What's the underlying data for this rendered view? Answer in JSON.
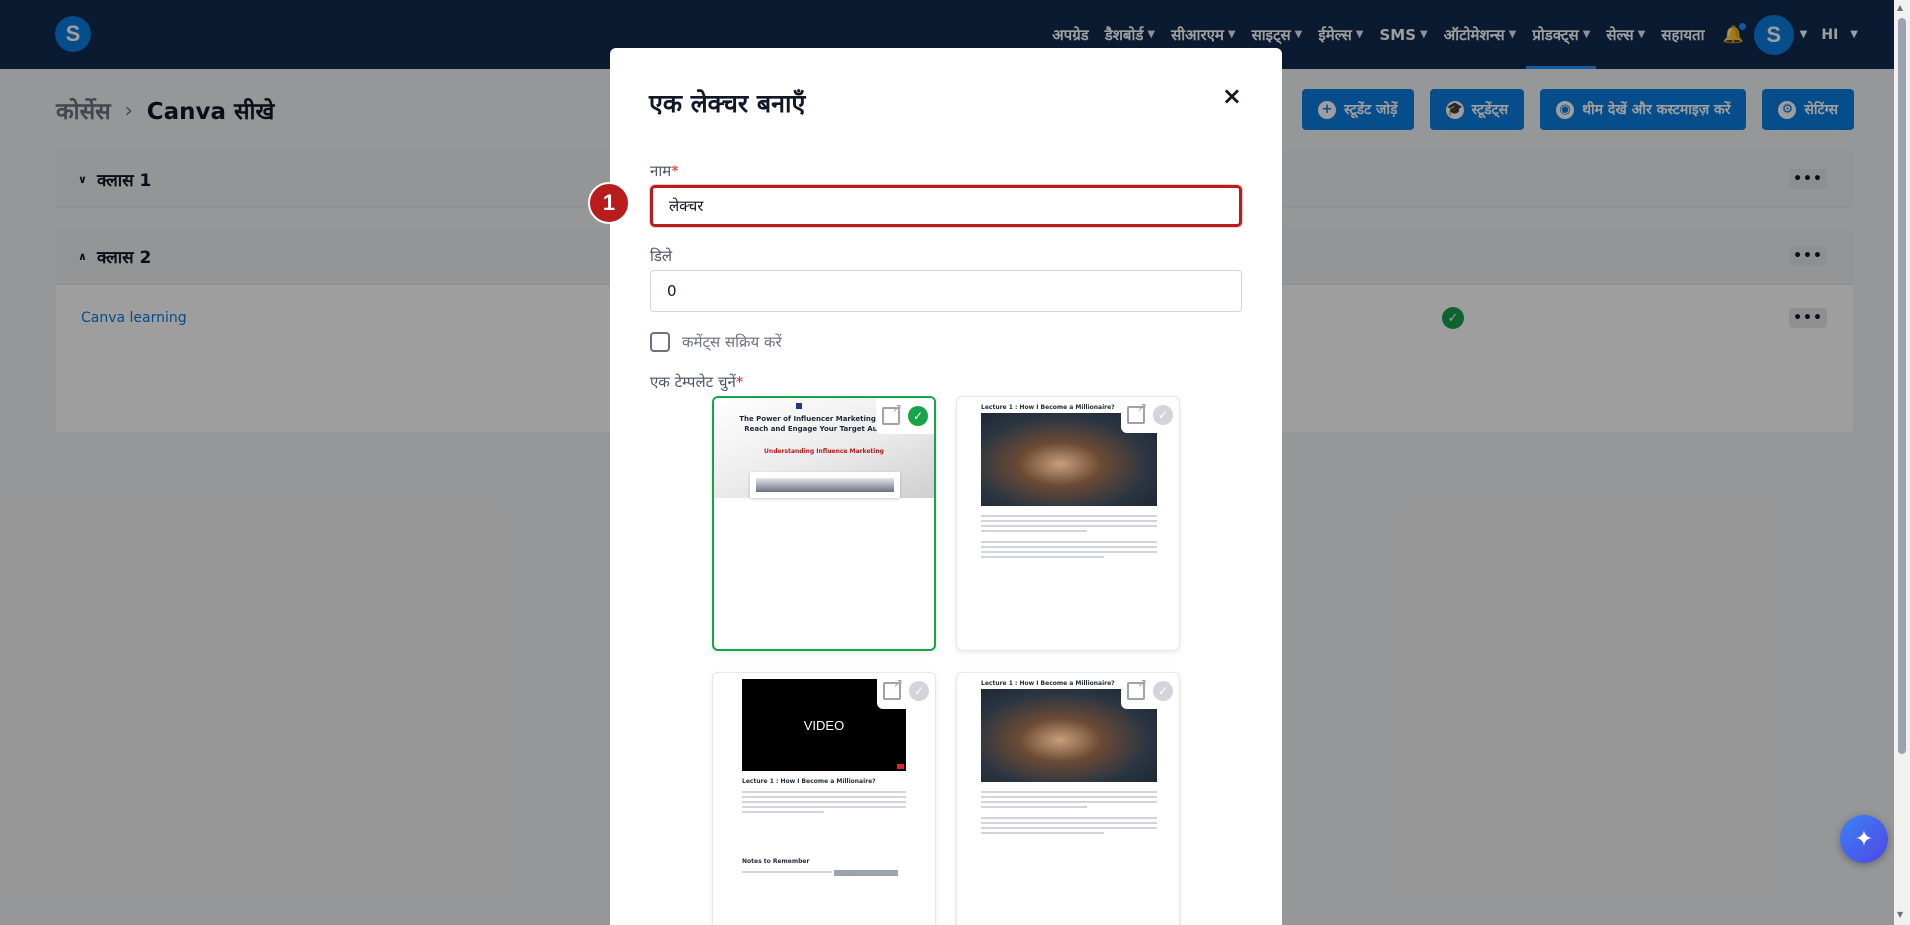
{
  "app": {
    "logo_letter": "S"
  },
  "nav": {
    "items": [
      {
        "label": "अपग्रेड",
        "has_menu": false
      },
      {
        "label": "डैशबोर्ड",
        "has_menu": true
      },
      {
        "label": "सीआरएम",
        "has_menu": true
      },
      {
        "label": "साइट्स",
        "has_menu": true
      },
      {
        "label": "ईमेल्स",
        "has_menu": true
      },
      {
        "label": "SMS",
        "has_menu": true
      },
      {
        "label": "ऑटोमेशन्स",
        "has_menu": true
      },
      {
        "label": "प्रोडक्ट्स",
        "has_menu": true,
        "active": true
      },
      {
        "label": "सेल्स",
        "has_menu": true
      },
      {
        "label": "सहायता",
        "has_menu": false
      }
    ],
    "avatar_letter": "S",
    "language": "HI"
  },
  "breadcrumb": {
    "root": "कोर्सेस",
    "current": "Canva सीखे"
  },
  "actions": {
    "add_student": "स्टूडेंट जोड़ें",
    "students": "स्टूडेंट्स",
    "theme": "थीम देखें और कस्टमाइज़ करें",
    "settings": "सेटिंग्स"
  },
  "classes": [
    {
      "title": "क्लास 1",
      "expanded": false,
      "lectures": []
    },
    {
      "title": "क्लास 2",
      "expanded": true,
      "lectures": [
        {
          "title": "Canva learning",
          "published": true
        }
      ]
    }
  ],
  "modal": {
    "title": "एक लेक्चर बनाएँ",
    "close": "×",
    "name_label": "नाम",
    "name_value": "लेक्चर",
    "delay_label": "डिले",
    "delay_value": "0",
    "comments_label": "कमेंट्स सक्रिय करें",
    "template_label": "एक टेम्पलेट चुनें",
    "required_mark": "*",
    "step_number": "1",
    "templates": [
      {
        "heading": "The Power of Influencer Marketing: How to Reach and Engage Your Target Audience",
        "subheading": "Understanding Influence Marketing",
        "selected": true
      },
      {
        "heading": "Lecture 1 : How I Become a Millionaire?",
        "selected": false
      },
      {
        "heading": "Lecture 1 : How I Become a Millionaire?",
        "video_label": "VIDEO",
        "notes": "Notes to Remember",
        "selected": false
      },
      {
        "heading": "Lecture 1 : How I Become a Millionaire?",
        "selected": false
      }
    ]
  },
  "colors": {
    "nav_bg": "#0f2a4f",
    "primary": "#0b7ce0",
    "success": "#16a34a",
    "focus_red": "#b91c1c"
  }
}
